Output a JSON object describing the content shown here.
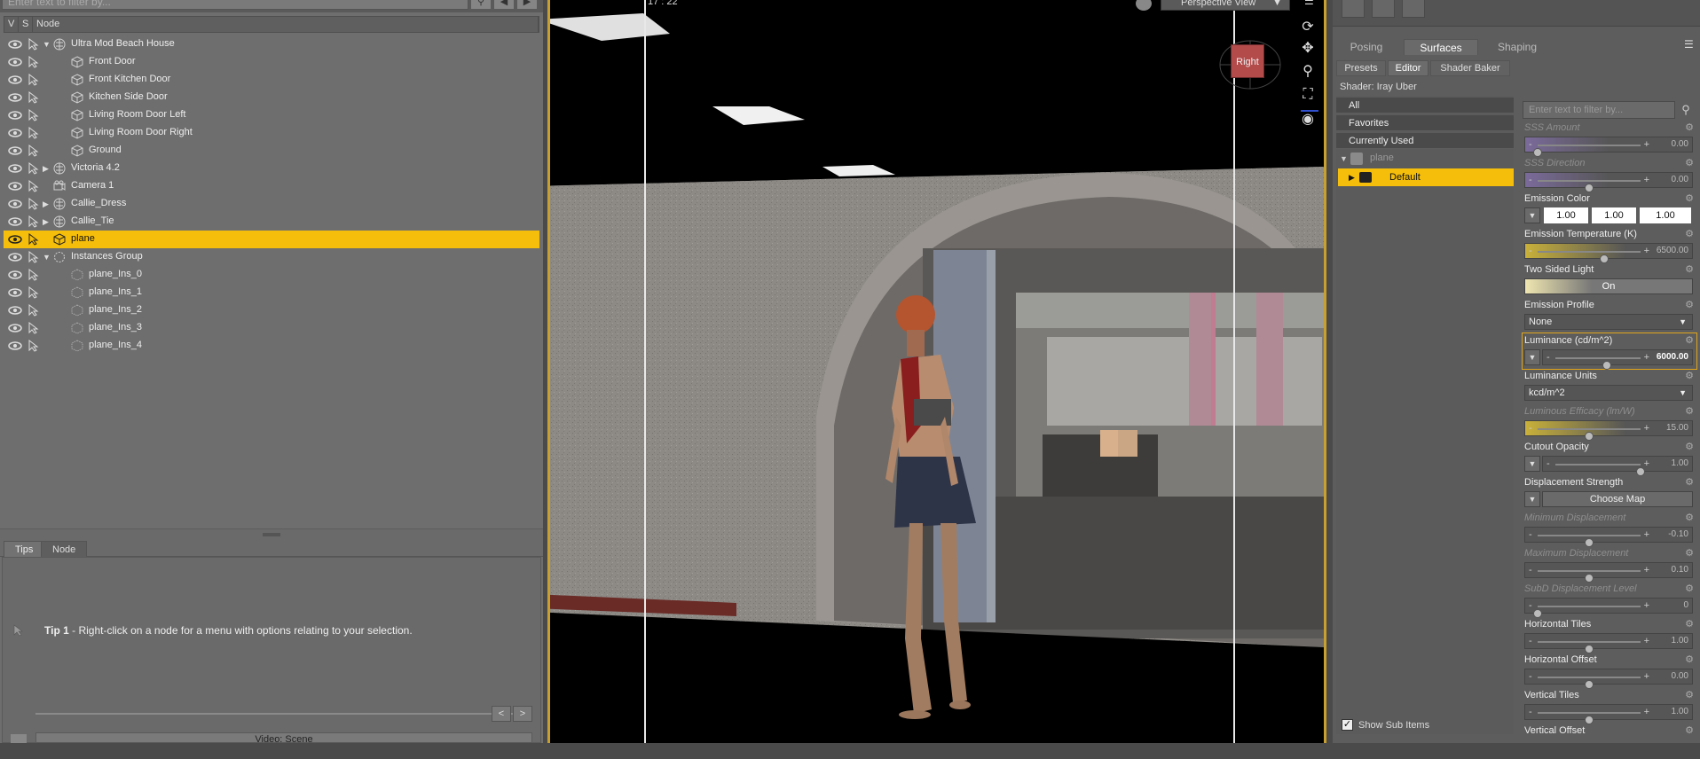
{
  "scene": {
    "filter_placeholder": "Enter text to filter by...",
    "columns": {
      "v": "V",
      "s": "S",
      "node": "Node"
    },
    "nodes": [
      {
        "label": "Ultra Mod Beach House",
        "level": 0,
        "expander": "open",
        "icon": "figure-icon"
      },
      {
        "label": "Front Door",
        "level": 1,
        "expander": "none",
        "icon": "prop-icon"
      },
      {
        "label": "Front Kitchen Door",
        "level": 1,
        "expander": "none",
        "icon": "prop-icon"
      },
      {
        "label": "Kitchen Side Door",
        "level": 1,
        "expander": "none",
        "icon": "prop-icon"
      },
      {
        "label": "Living Room Door Left",
        "level": 1,
        "expander": "none",
        "icon": "prop-icon"
      },
      {
        "label": "Living Room Door Right",
        "level": 1,
        "expander": "none",
        "icon": "prop-icon"
      },
      {
        "label": "Ground",
        "level": 1,
        "expander": "none",
        "icon": "prop-icon"
      },
      {
        "label": "Victoria 4.2",
        "level": 0,
        "expander": "closed",
        "icon": "figure-icon"
      },
      {
        "label": "Camera 1",
        "level": 0,
        "expander": "none",
        "icon": "camera-icon"
      },
      {
        "label": "Callie_Dress",
        "level": 0,
        "expander": "closed",
        "icon": "figure-icon"
      },
      {
        "label": "Callie_Tie",
        "level": 0,
        "expander": "closed",
        "icon": "figure-icon"
      },
      {
        "label": "plane",
        "level": 0,
        "expander": "none",
        "icon": "prop-icon",
        "selected": true
      },
      {
        "label": "Instances Group",
        "level": 0,
        "expander": "open",
        "icon": "group-icon"
      },
      {
        "label": "plane_Ins_0",
        "level": 1,
        "expander": "none",
        "icon": "instance-icon"
      },
      {
        "label": "plane_Ins_1",
        "level": 1,
        "expander": "none",
        "icon": "instance-icon"
      },
      {
        "label": "plane_Ins_2",
        "level": 1,
        "expander": "none",
        "icon": "instance-icon"
      },
      {
        "label": "plane_Ins_3",
        "level": 1,
        "expander": "none",
        "icon": "instance-icon"
      },
      {
        "label": "plane_Ins_4",
        "level": 1,
        "expander": "none",
        "icon": "instance-icon"
      }
    ]
  },
  "bottom_tabs": [
    "Tips",
    "Node"
  ],
  "tip": {
    "title": "Tip 1",
    "text": " - Right-click on a node for a menu with options relating to your selection."
  },
  "nav": {
    "prev": "<",
    "next": ">"
  },
  "video_bar": "Video: Scene",
  "viewport": {
    "frame": "17 : 22",
    "view_mode": "Perspective View",
    "cube_face": "Right"
  },
  "surfaces": {
    "mode_tabs": [
      "Posing",
      "Surfaces",
      "Shaping"
    ],
    "active_mode": "Surfaces",
    "sub_tabs": [
      "Presets",
      "Editor",
      "Shader Baker"
    ],
    "active_sub": "Editor",
    "shader": "Shader: Iray Uber",
    "categories": [
      "All",
      "Favorites",
      "Currently Used"
    ],
    "tree_root": "plane",
    "tree_child": "Default",
    "show_sub_items": "Show Sub Items",
    "filter_placeholder": "Enter text to filter by...",
    "properties": {
      "sss_amount": {
        "label": "SSS Amount",
        "value": "0.00",
        "level": 0.0
      },
      "sss_direction": {
        "label": "SSS Direction",
        "value": "0.00",
        "level": 0.5
      },
      "emission_color": {
        "label": "Emission Color",
        "r": "1.00",
        "g": "1.00",
        "b": "1.00"
      },
      "emission_temperature": {
        "label": "Emission Temperature (K)",
        "value": "6500.00",
        "level": 0.65
      },
      "two_sided_light": {
        "label": "Two Sided Light",
        "value": "On"
      },
      "emission_profile": {
        "label": "Emission Profile",
        "value": "None"
      },
      "luminance": {
        "label": "Luminance (cd/m^2)",
        "value": "6000.00",
        "level": 0.6
      },
      "luminance_units": {
        "label": "Luminance Units",
        "value": "kcd/m^2"
      },
      "luminous_efficacy": {
        "label": "Luminous Efficacy (lm/W)",
        "value": "15.00",
        "level": 0.5
      },
      "cutout_opacity": {
        "label": "Cutout Opacity",
        "value": "1.00",
        "level": 1.0
      },
      "displacement_strength": {
        "label": "Displacement Strength",
        "button": "Choose Map"
      },
      "min_displacement": {
        "label": "Minimum Displacement",
        "value": "-0.10",
        "level": 0.5
      },
      "max_displacement": {
        "label": "Maximum Displacement",
        "value": "0.10",
        "level": 0.5
      },
      "subd_level": {
        "label": "SubD Displacement Level",
        "value": "0",
        "level": 0.0
      },
      "horizontal_tiles": {
        "label": "Horizontal Tiles",
        "value": "1.00",
        "level": 0.5
      },
      "horizontal_offset": {
        "label": "Horizontal Offset",
        "value": "0.00",
        "level": 0.5
      },
      "vertical_tiles": {
        "label": "Vertical Tiles",
        "value": "1.00",
        "level": 0.5
      },
      "vertical_offset": {
        "label": "Vertical Offset"
      }
    }
  },
  "colors": {
    "selection": "#f5be0b",
    "panel": "#6e6e6e",
    "emission_red": "#b34b4b"
  }
}
